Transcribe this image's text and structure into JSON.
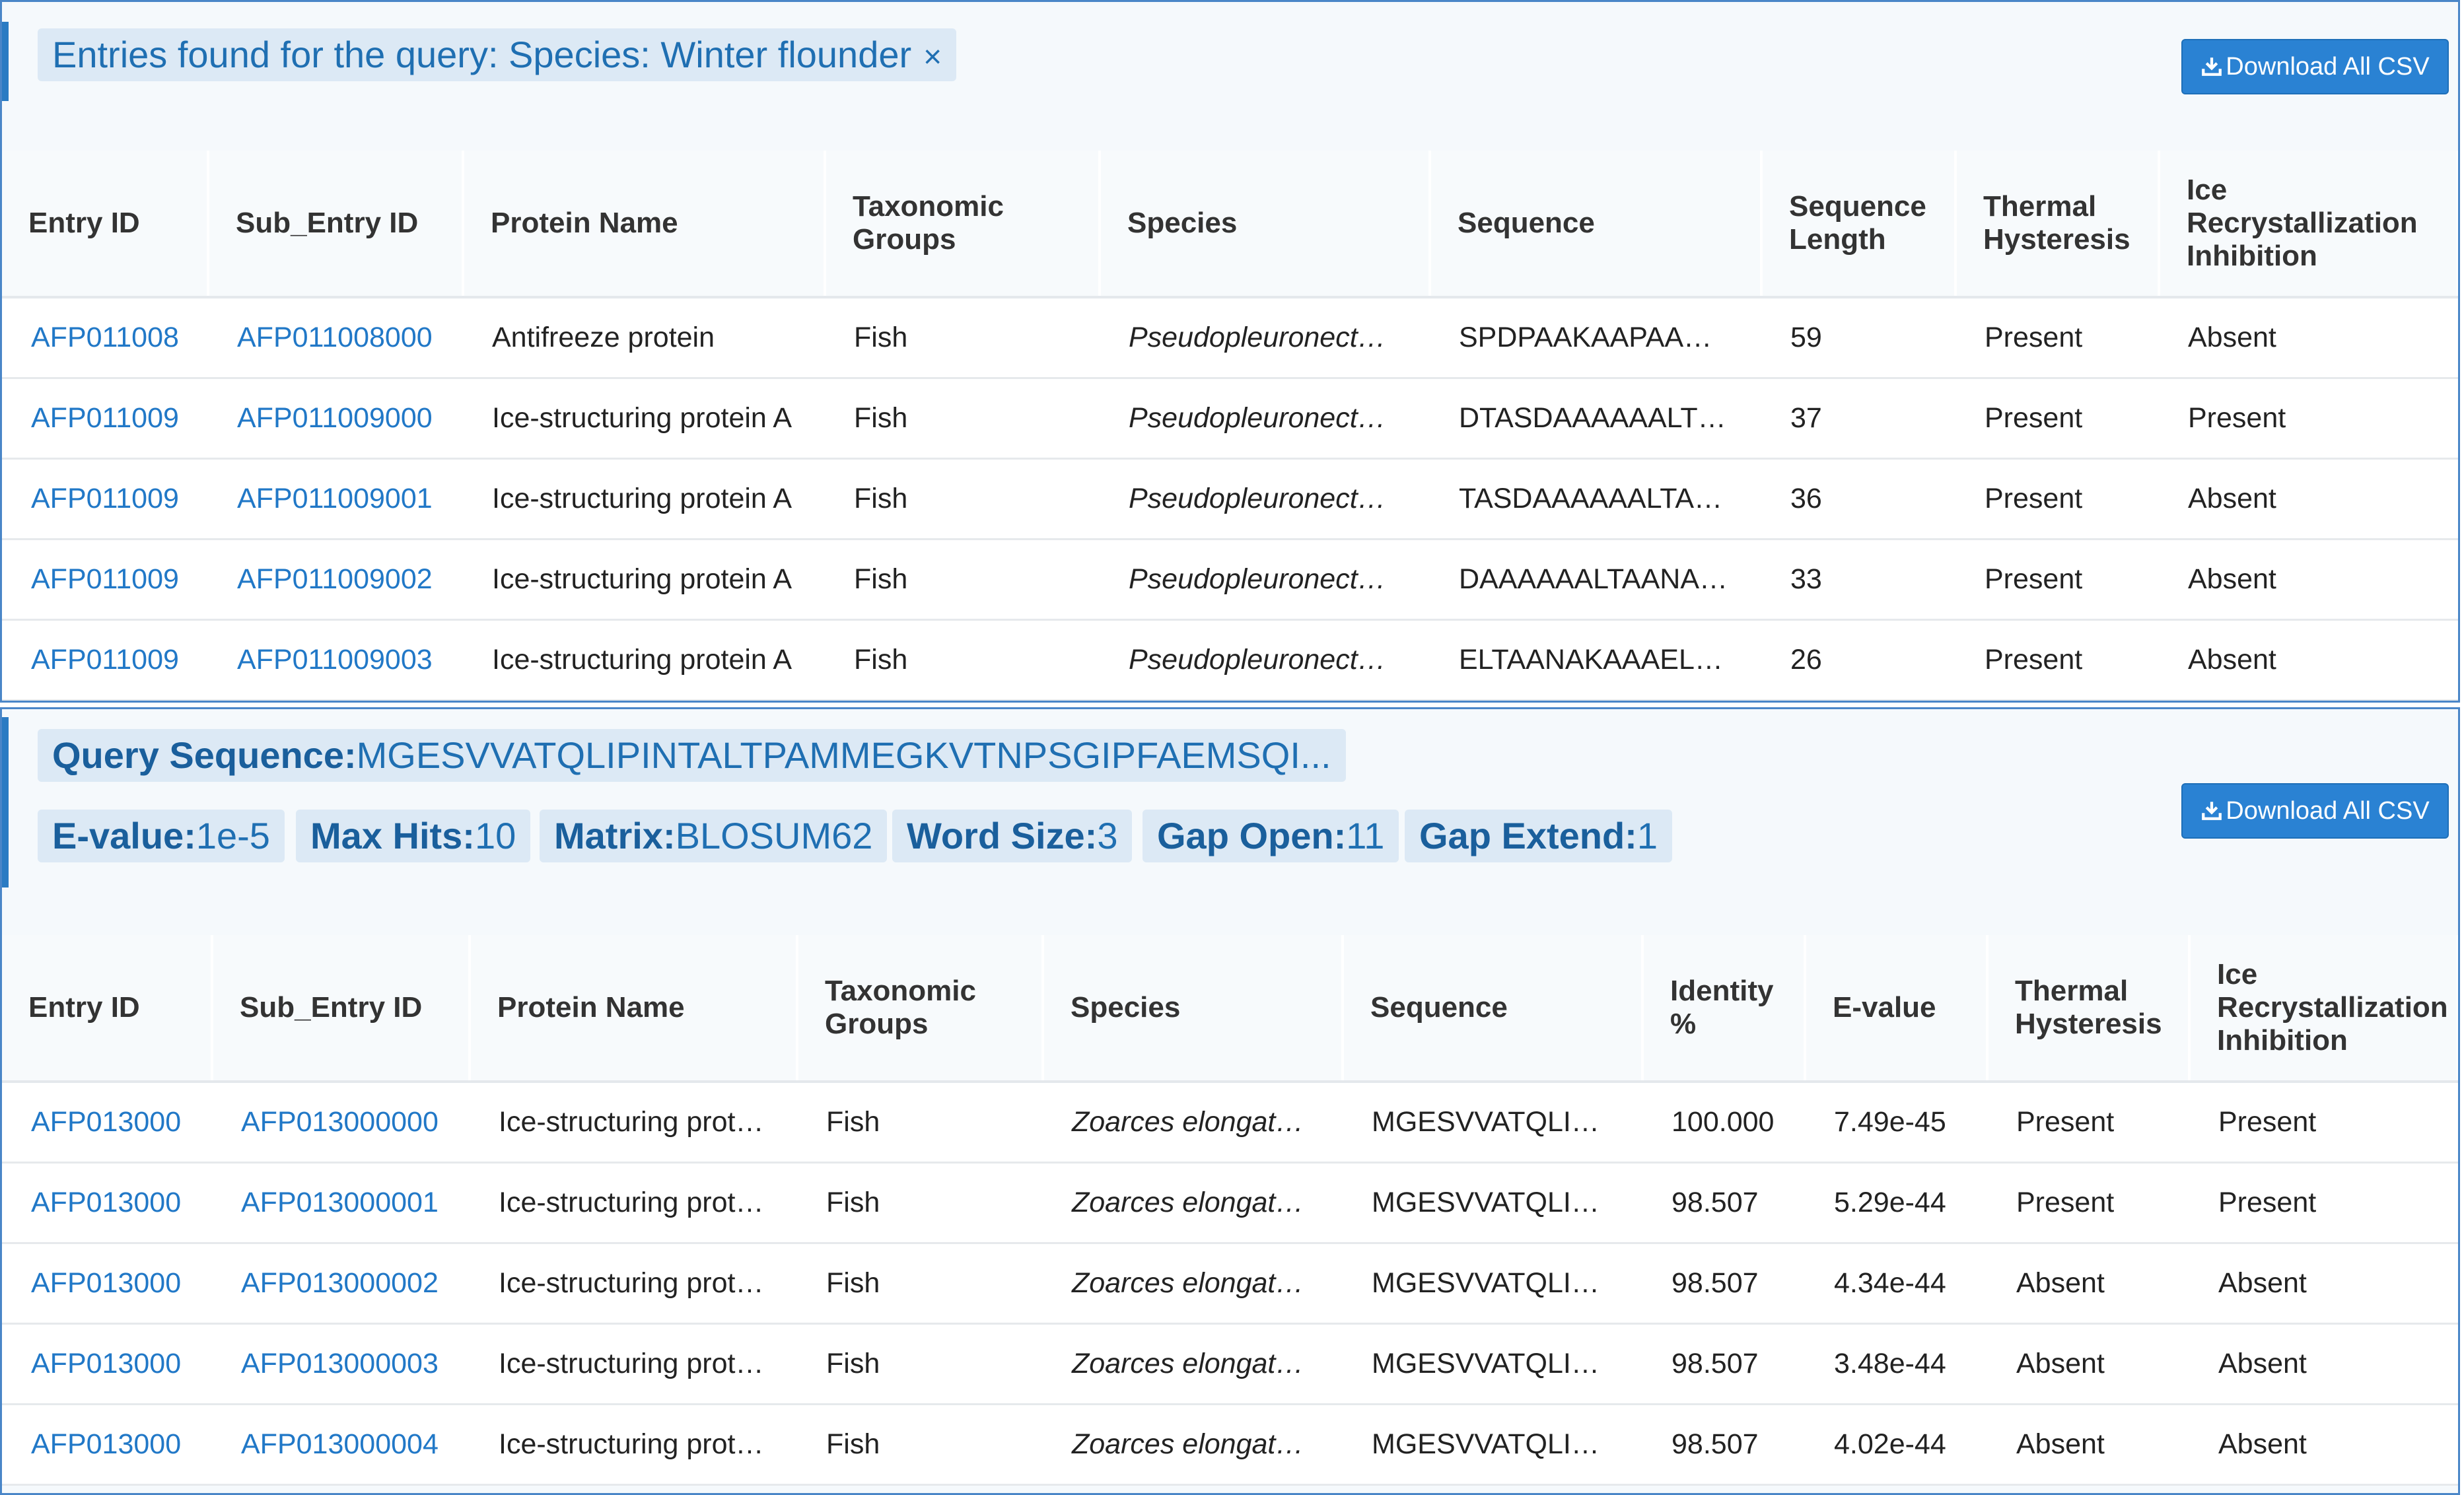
{
  "search_panel": {
    "query_label": "Entries found for the query: Species: Winter flounder",
    "close_glyph": "×",
    "download_label": "Download All CSV",
    "download_icon": "download-icon",
    "columns": [
      "Entry ID",
      "Sub_Entry ID",
      "Protein Name",
      "Taxonomic Groups",
      "Species",
      "Sequence",
      "Sequence Length",
      "Thermal Hysteresis",
      "Ice Recrystallization Inhibition"
    ],
    "rows": [
      [
        "AFP011008",
        "AFP011008000",
        "Antifreeze protein",
        "Fish",
        "Pseudopleuronect…",
        "SPDPAAKAAPAA…",
        "59",
        "Present",
        "Absent"
      ],
      [
        "AFP011009",
        "AFP011009000",
        "Ice-structuring protein A",
        "Fish",
        "Pseudopleuronect…",
        "DTASDAAAAAALT…",
        "37",
        "Present",
        "Present"
      ],
      [
        "AFP011009",
        "AFP011009001",
        "Ice-structuring protein A",
        "Fish",
        "Pseudopleuronect…",
        "TASDAAAAAALTA…",
        "36",
        "Present",
        "Absent"
      ],
      [
        "AFP011009",
        "AFP011009002",
        "Ice-structuring protein A",
        "Fish",
        "Pseudopleuronect…",
        "DAAAAAALTAANA…",
        "33",
        "Present",
        "Absent"
      ],
      [
        "AFP011009",
        "AFP011009003",
        "Ice-structuring protein A",
        "Fish",
        "Pseudopleuronect…",
        "ELTAANAKAAAEL…",
        "26",
        "Present",
        "Absent"
      ]
    ]
  },
  "blast_panel": {
    "query_sequence_label": "Query Sequence:",
    "query_sequence_value": "MGESVVATQLIPINTALTPAMMEGKVTNPSGIPFAEMSQI...",
    "params": [
      {
        "label": "E-value:",
        "value": "1e-5"
      },
      {
        "label": "Max Hits:",
        "value": "10"
      },
      {
        "label": "Matrix:",
        "value": "BLOSUM62"
      },
      {
        "label": "Word Size:",
        "value": "3"
      },
      {
        "label": "Gap Open:",
        "value": "11"
      },
      {
        "label": "Gap Extend:",
        "value": "1"
      }
    ],
    "download_label": "Download All CSV",
    "download_icon": "download-icon",
    "columns": [
      "Entry ID",
      "Sub_Entry ID",
      "Protein Name",
      "Taxonomic Groups",
      "Species",
      "Sequence",
      "Identity %",
      "E-value",
      "Thermal Hysteresis",
      "Ice Recrystallization Inhibition"
    ],
    "rows": [
      [
        "AFP013000",
        "AFP013000000",
        "Ice-structuring prot…",
        "Fish",
        "Zoarces elongat…",
        "MGESVVATQLI…",
        "100.000",
        "7.49e-45",
        "Present",
        "Present"
      ],
      [
        "AFP013000",
        "AFP013000001",
        "Ice-structuring prot…",
        "Fish",
        "Zoarces elongat…",
        "MGESVVATQLI…",
        "98.507",
        "5.29e-44",
        "Present",
        "Present"
      ],
      [
        "AFP013000",
        "AFP013000002",
        "Ice-structuring prot…",
        "Fish",
        "Zoarces elongat…",
        "MGESVVATQLI…",
        "98.507",
        "4.34e-44",
        "Absent",
        "Absent"
      ],
      [
        "AFP013000",
        "AFP013000003",
        "Ice-structuring prot…",
        "Fish",
        "Zoarces elongat…",
        "MGESVVATQLI…",
        "98.507",
        "3.48e-44",
        "Absent",
        "Absent"
      ],
      [
        "AFP013000",
        "AFP013000004",
        "Ice-structuring prot…",
        "Fish",
        "Zoarces elongat…",
        "MGESVVATQLI…",
        "98.507",
        "4.02e-44",
        "Absent",
        "Absent"
      ]
    ]
  },
  "colors": {
    "accent": "#2a7bc3",
    "link": "#2178c7",
    "chip_bg": "#dce9f5",
    "button_bg": "#2a82d3"
  }
}
